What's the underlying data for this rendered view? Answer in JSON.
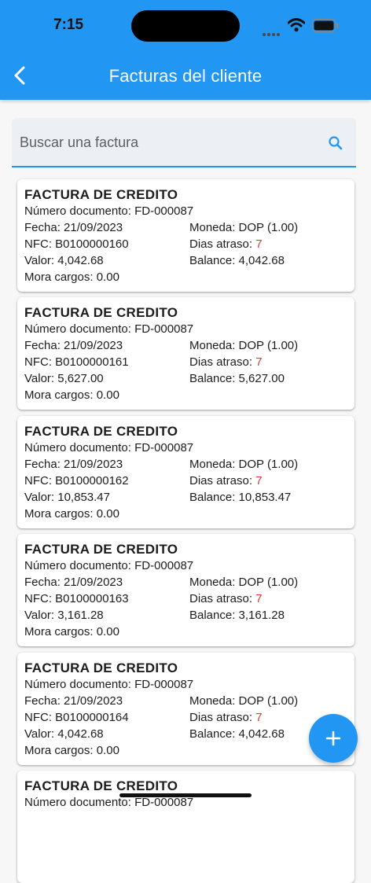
{
  "status_bar": {
    "time": "7:15"
  },
  "header": {
    "title": "Facturas del cliente",
    "back_icon": "chevron-left-icon"
  },
  "search": {
    "placeholder": "Buscar una factura",
    "icon": "search-icon"
  },
  "invoices": [
    {
      "title": "FACTURA DE CREDITO",
      "doc_label": "Número documento:",
      "doc": "FD-000087",
      "fecha_label": "Fecha:",
      "fecha": "21/09/2023",
      "moneda_label": "Moneda:",
      "moneda": "DOP (1.00)",
      "nfc_label": "NFC:",
      "nfc": "B0100000160",
      "dias_label": "Dias atraso:",
      "dias": "7",
      "valor_label": "Valor:",
      "valor": "4,042.68",
      "balance_label": "Balance:",
      "balance": "4,042.68",
      "mora_label": "Mora cargos:",
      "mora": "0.00"
    },
    {
      "title": "FACTURA DE CREDITO",
      "doc_label": "Número documento:",
      "doc": "FD-000087",
      "fecha_label": "Fecha:",
      "fecha": "21/09/2023",
      "moneda_label": "Moneda:",
      "moneda": "DOP (1.00)",
      "nfc_label": "NFC:",
      "nfc": "B0100000161",
      "dias_label": "Dias atraso:",
      "dias": "7",
      "valor_label": "Valor:",
      "valor": "5,627.00",
      "balance_label": "Balance:",
      "balance": "5,627.00",
      "mora_label": "Mora cargos:",
      "mora": "0.00"
    },
    {
      "title": "FACTURA DE CREDITO",
      "doc_label": "Número documento:",
      "doc": "FD-000087",
      "fecha_label": "Fecha:",
      "fecha": "21/09/2023",
      "moneda_label": "Moneda:",
      "moneda": "DOP (1.00)",
      "nfc_label": "NFC:",
      "nfc": "B0100000162",
      "dias_label": "Dias atraso:",
      "dias": "7",
      "valor_label": "Valor:",
      "valor": "10,853.47",
      "balance_label": "Balance:",
      "balance": "10,853.47",
      "mora_label": "Mora cargos:",
      "mora": "0.00"
    },
    {
      "title": "FACTURA DE CREDITO",
      "doc_label": "Número documento:",
      "doc": "FD-000087",
      "fecha_label": "Fecha:",
      "fecha": "21/09/2023",
      "moneda_label": "Moneda:",
      "moneda": "DOP (1.00)",
      "nfc_label": "NFC:",
      "nfc": "B0100000163",
      "dias_label": "Dias atraso:",
      "dias": "7",
      "valor_label": "Valor:",
      "valor": "3,161.28",
      "balance_label": "Balance:",
      "balance": "3,161.28",
      "mora_label": "Mora cargos:",
      "mora": "0.00"
    },
    {
      "title": "FACTURA DE CREDITO",
      "doc_label": "Número documento:",
      "doc": "FD-000087",
      "fecha_label": "Fecha:",
      "fecha": "21/09/2023",
      "moneda_label": "Moneda:",
      "moneda": "DOP (1.00)",
      "nfc_label": "NFC:",
      "nfc": "B0100000164",
      "dias_label": "Dias atraso:",
      "dias": "7",
      "valor_label": "Valor:",
      "valor": "4,042.68",
      "balance_label": "Balance:",
      "balance": "4,042.68",
      "mora_label": "Mora cargos:",
      "mora": "0.00"
    },
    {
      "title": "FACTURA DE CREDITO",
      "doc_label": "Número documento:",
      "doc": "FD-000087"
    }
  ],
  "fab": {
    "icon": "plus-icon"
  },
  "colors": {
    "primary": "#2196f3",
    "overdue": "#e53935"
  }
}
